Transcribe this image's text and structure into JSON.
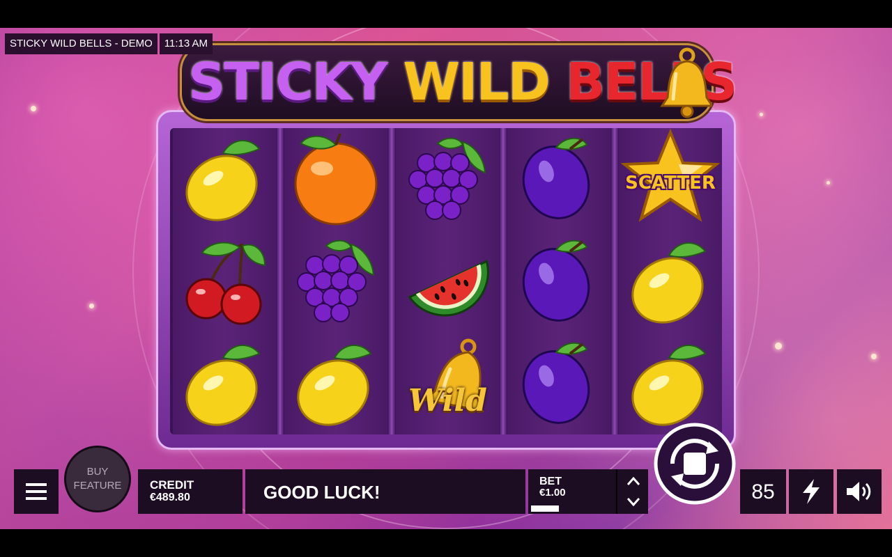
{
  "window": {
    "title": "STICKY WILD BELLS - DEMO",
    "clock": "11:13 AM"
  },
  "logo": {
    "word1": "STICKY",
    "word2": "WILD",
    "word3": "BELLS"
  },
  "reels": [
    [
      "lemon",
      "cherry",
      "lemon"
    ],
    [
      "orange",
      "grapes",
      "lemon"
    ],
    [
      "grapes",
      "watermelon",
      "wild-bell"
    ],
    [
      "plum",
      "plum",
      "plum"
    ],
    [
      "scatter-star",
      "lemon",
      "lemon"
    ]
  ],
  "symbols": {
    "scatter_label": "SCATTER",
    "wild_label": "Wild"
  },
  "controls": {
    "buy_feature": "BUY FEATURE",
    "credit_label": "CREDIT",
    "credit_value": "€489.80",
    "message": "GOOD LUCK!",
    "bet_label": "BET",
    "bet_value": "€1.00",
    "bet_level": 0.25,
    "autospin_count": "85",
    "icons": {
      "menu": "hamburger-menu-icon",
      "bet_up": "chevron-up-icon",
      "bet_down": "chevron-down-icon",
      "spin": "stop-spin-icon",
      "turbo": "lightning-icon",
      "sound": "speaker-icon"
    }
  },
  "colors": {
    "panel": "#1d0d22",
    "reel_bg": "#4a1a66",
    "frame": "#b665d6"
  }
}
